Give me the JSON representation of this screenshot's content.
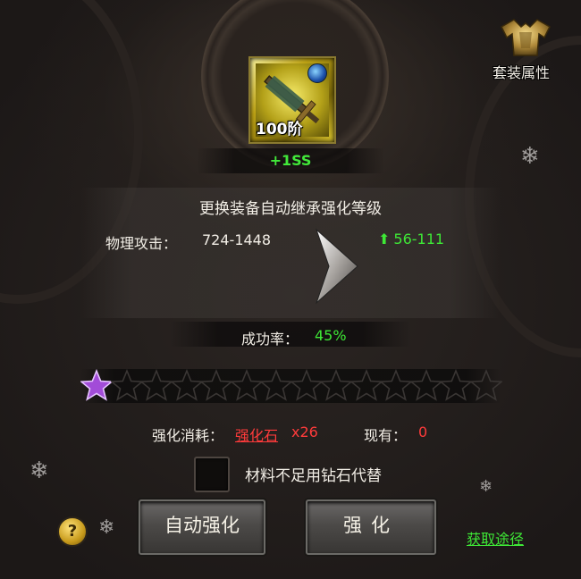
{
  "item": {
    "level_label": "100阶",
    "bonus": "+1SS",
    "icon": "sword-icon",
    "gem_icon": "blue-gem-icon"
  },
  "info": {
    "inherit_text": "更换装备自动继承强化等级",
    "attr_label": "物理攻击：",
    "attr_value": "724-1448",
    "attr_gain": "56-111",
    "gain_arrow_icon": "up-arrow-icon"
  },
  "success": {
    "label": "成功率：",
    "value": "45%"
  },
  "stars": {
    "total": 14,
    "filled": 1,
    "filled_color": "#a24cd8",
    "empty_color": "#3a3634"
  },
  "cost": {
    "label": "强化消耗：",
    "item": "强化石",
    "qty": "x26",
    "have_label": "现有：",
    "have_value": "0"
  },
  "option": {
    "label": "材料不足用钻石代替",
    "checked": false
  },
  "buttons": {
    "auto": "自动强化",
    "enhance": "强化"
  },
  "help": {
    "glyph": "?"
  },
  "source_link": "获取途径",
  "set_attr": {
    "label": "套装属性",
    "icon": "armor-icon"
  },
  "colors": {
    "green": "#3ee836",
    "red": "#ff3b3b",
    "text": "#f2eee6"
  }
}
